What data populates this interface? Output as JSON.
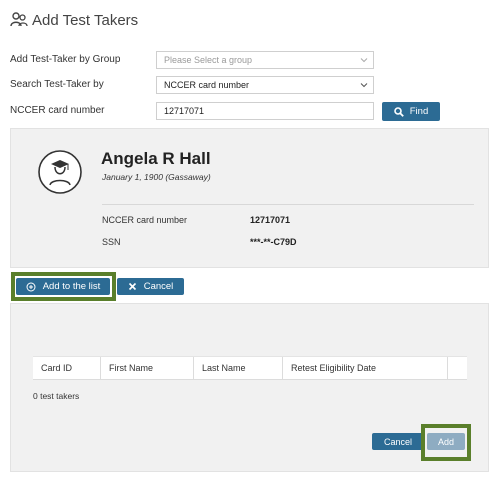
{
  "page": {
    "title": "Add Test Takers"
  },
  "form": {
    "group_label": "Add Test-Taker by Group",
    "group_placeholder": "Please Select a group",
    "search_label": "Search Test-Taker by",
    "search_value": "NCCER card number",
    "card_label": "NCCER card number",
    "card_value": "12717071",
    "find_label": "Find"
  },
  "profile": {
    "name": "Angela R Hall",
    "dob": "January 1, 1900 (Gassaway)",
    "fields": [
      {
        "label": "NCCER card number",
        "value": "12717071"
      },
      {
        "label": "SSN",
        "value": "***-**-C79D"
      }
    ]
  },
  "actions": {
    "add_to_list": "Add to the list",
    "cancel": "Cancel"
  },
  "table": {
    "columns": [
      "Card ID",
      "First Name",
      "Last Name",
      "Retest Eligibility Date"
    ],
    "count_text": "0 test takers"
  },
  "footer": {
    "cancel": "Cancel",
    "add": "Add"
  },
  "colors": {
    "primary": "#2c6b94",
    "secondary": "#8eacc2",
    "highlight": "#5a7f2b",
    "panel": "#f1f1f1"
  }
}
